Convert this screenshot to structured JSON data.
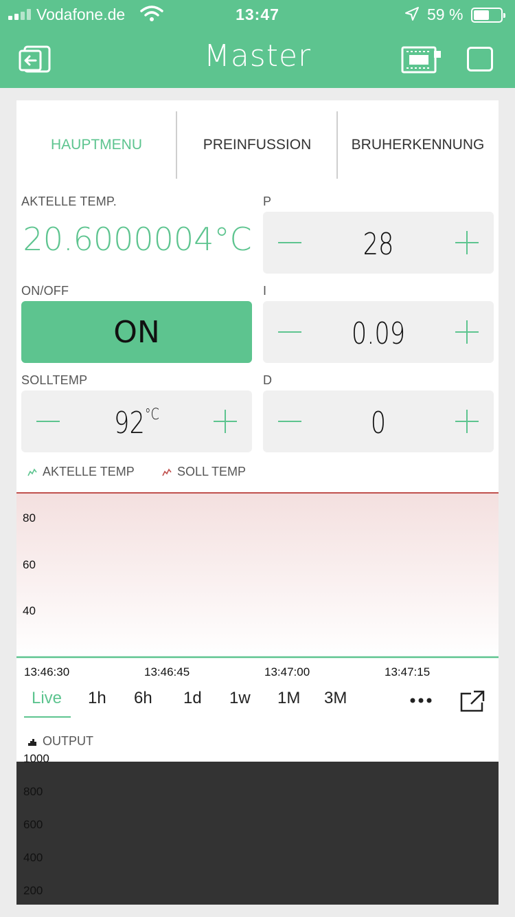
{
  "status_bar": {
    "carrier": "Vodafone.de",
    "time": "13:47",
    "battery_percent": "59 %",
    "battery_level": 0.59
  },
  "nav": {
    "title": "Master"
  },
  "tabs": [
    {
      "label": "HAUPTMENU",
      "active": true
    },
    {
      "label": "PREINFUSSION",
      "active": false
    },
    {
      "label": "BRUHERKENNUNG",
      "active": false
    }
  ],
  "widgets": {
    "current_temp": {
      "label": "AKTELLE TEMP.",
      "value": "20.6000004°C"
    },
    "p": {
      "label": "P",
      "value": "28"
    },
    "on_off": {
      "label": "ON/OFF",
      "value": "ON"
    },
    "i": {
      "label": "I",
      "value": "0.09"
    },
    "soll_temp": {
      "label": "SOLLTEMP",
      "value": "92",
      "unit": "°C"
    },
    "d": {
      "label": "D",
      "value": "0"
    }
  },
  "chart_data": [
    {
      "type": "area",
      "series": [
        {
          "name": "AKTELLE TEMP",
          "color": "#5dc48f"
        },
        {
          "name": "SOLL TEMP",
          "color": "#c0504d"
        }
      ],
      "y_ticks": [
        "80",
        "60",
        "40"
      ],
      "x_ticks": [
        "13:46:30",
        "13:46:45",
        "13:47:00",
        "13:47:15"
      ]
    },
    {
      "type": "bar",
      "series": [
        {
          "name": "OUTPUT"
        }
      ],
      "y_ticks": [
        "1000",
        "800",
        "600",
        "400",
        "200"
      ]
    }
  ],
  "time_ranges": [
    "Live",
    "1h",
    "6h",
    "1d",
    "1w",
    "1M",
    "3M"
  ],
  "active_range": "Live",
  "colors": {
    "accent": "#5dc48f",
    "soll_line": "#c0504d",
    "output_fill": "#333333"
  }
}
